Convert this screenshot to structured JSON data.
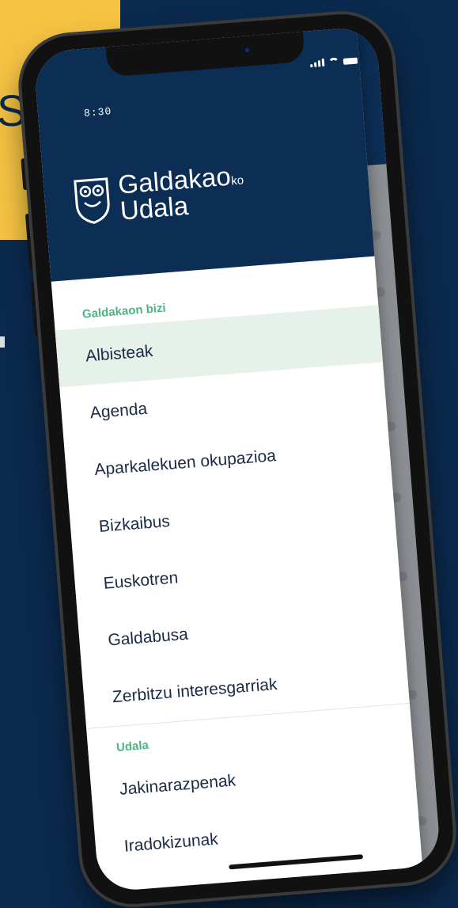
{
  "background": {
    "navy": "#0b2a4e",
    "yellow": "#f6c443",
    "edge_letter": "S"
  },
  "status_bar": {
    "time": "8:30"
  },
  "app": {
    "logo": {
      "line1": "Galdakao",
      "line1_suffix": "ko",
      "line2": "Udala"
    }
  },
  "menu": {
    "sections": [
      {
        "label": "Galdakaon bizi",
        "items": [
          {
            "label": "Albisteak",
            "active": true
          },
          {
            "label": "Agenda"
          },
          {
            "label": "Aparkalekuen okupazioa"
          },
          {
            "label": "Bizkaibus"
          },
          {
            "label": "Euskotren"
          },
          {
            "label": "Galdabusa"
          },
          {
            "label": "Zerbitzu interesgarriak"
          }
        ]
      },
      {
        "label": "Udala",
        "items": [
          {
            "label": "Jakinarazpenak"
          },
          {
            "label": "Iradokizunak"
          }
        ]
      }
    ]
  },
  "colors": {
    "drawer_header": "#0c2d54",
    "section_label": "#4fb483",
    "active_item_bg": "#e5f1e9",
    "item_text": "#1b2b45"
  }
}
